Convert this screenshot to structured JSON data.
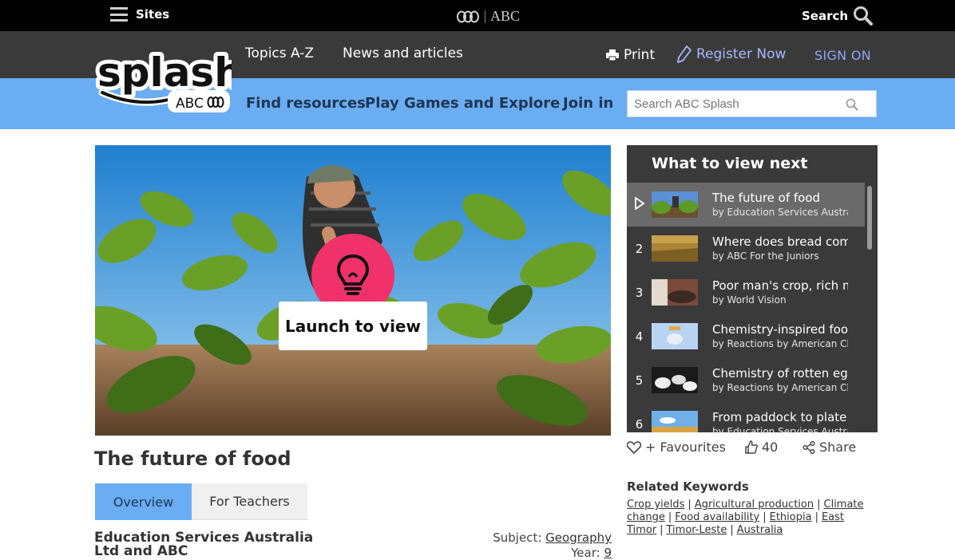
{
  "topbar": {
    "sites_label": "Sites",
    "logo_text": "ABC",
    "search_label": "Search"
  },
  "mainnav": {
    "topics": "Topics A-Z",
    "news": "News and articles",
    "print": "Print",
    "register": "Register Now",
    "signon": "SIGN ON"
  },
  "brand": {
    "logo_word": "splash",
    "logo_sub": "ABC"
  },
  "subnav": {
    "find": "Find resources",
    "play": "Play Games and Explore",
    "join": "Join in",
    "search_placeholder": "Search ABC Splash"
  },
  "hero": {
    "launch_label": "Launch to view"
  },
  "resource": {
    "title": "The future of food",
    "tabs": [
      "Overview",
      "For Teachers"
    ],
    "publisher": "Education Services Australia Ltd and ABC",
    "subject_label": "Subject:",
    "subject_value": "Geography",
    "year_label": "Year:",
    "year_value": "9"
  },
  "view_next": {
    "heading": "What to view next",
    "items": [
      {
        "num": "",
        "title": "The future of food",
        "by": "by Education Services Australia Ltd"
      },
      {
        "num": "2",
        "title": "Where does bread come from?",
        "by": "by ABC For the Juniors"
      },
      {
        "num": "3",
        "title": "Poor man's crop, rich man's food",
        "by": "by World Vision"
      },
      {
        "num": "4",
        "title": "Chemistry-inspired food",
        "by": "by Reactions by American Chemical Society"
      },
      {
        "num": "5",
        "title": "Chemistry of rotten eggs",
        "by": "by Reactions by American Chemical Society"
      },
      {
        "num": "6",
        "title": "From paddock to plate",
        "by": "by Education Services Australia"
      }
    ]
  },
  "actions": {
    "favourites": "+ Favourites",
    "likes": "40",
    "share": "Share"
  },
  "related": {
    "heading": "Related Keywords",
    "keywords": [
      "Crop yields",
      "Agricultural production",
      "Climate change",
      "Food availability",
      "Ethiopia",
      "East Timor",
      "Timor-Leste",
      "Australia"
    ]
  },
  "colors": {
    "abc_black": "#000000",
    "nav_dark": "#3a3a3a",
    "nav_blue": "#6aadf2",
    "accent_pink": "#f0316a",
    "register_blue": "#a9b8ff"
  }
}
